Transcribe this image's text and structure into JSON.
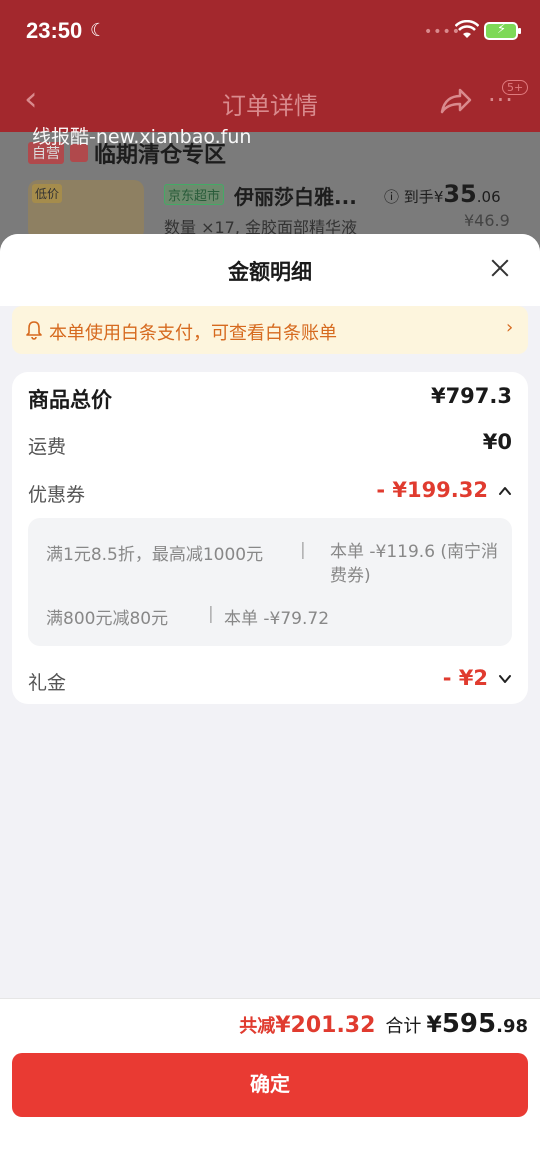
{
  "status_bar": {
    "time": "23:50"
  },
  "nav": {
    "title": "订单详情",
    "badge": "5+"
  },
  "watermark": "线报酷-new.xianbao.fun",
  "underlay": {
    "self_tag": "自营",
    "shop_name": "临期清仓专区",
    "thumb_label": "低价",
    "jd_tag": "京东超市",
    "product_name": "伊丽莎白雅...",
    "product_meta": "数量 ×17, 金胶面部精华液",
    "arrive_label": "到手",
    "arrive_currency": "¥",
    "arrive_int": "35",
    "arrive_dec": ".06",
    "original_price": "¥46.9"
  },
  "sheet": {
    "title": "金额明细",
    "notice": "本单使用白条支付，可查看白条账单",
    "rows": {
      "total_label": "商品总价",
      "total_value": "¥797.3",
      "shipping_label": "运费",
      "shipping_value": "¥0",
      "coupon_label": "优惠券",
      "coupon_value": "- ¥199.32",
      "gift_label": "礼金",
      "gift_value": "- ¥2"
    },
    "coupons": [
      {
        "desc": "满1元8.5折，最高减1000元",
        "detail": "本单 -¥119.6 (南宁消费券)"
      },
      {
        "desc": "满800元减80元",
        "detail": "本单 -¥79.72"
      }
    ]
  },
  "footer": {
    "saved_label": "共减",
    "saved_value": "¥201.32",
    "sum_label": "合计",
    "sum_currency": "¥",
    "sum_int": "595",
    "sum_dec": ".98",
    "confirm_label": "确定"
  },
  "colors": {
    "accent_red": "#e93a33",
    "discount_red": "#e03b2f",
    "notice_orange": "#d66a1f"
  }
}
